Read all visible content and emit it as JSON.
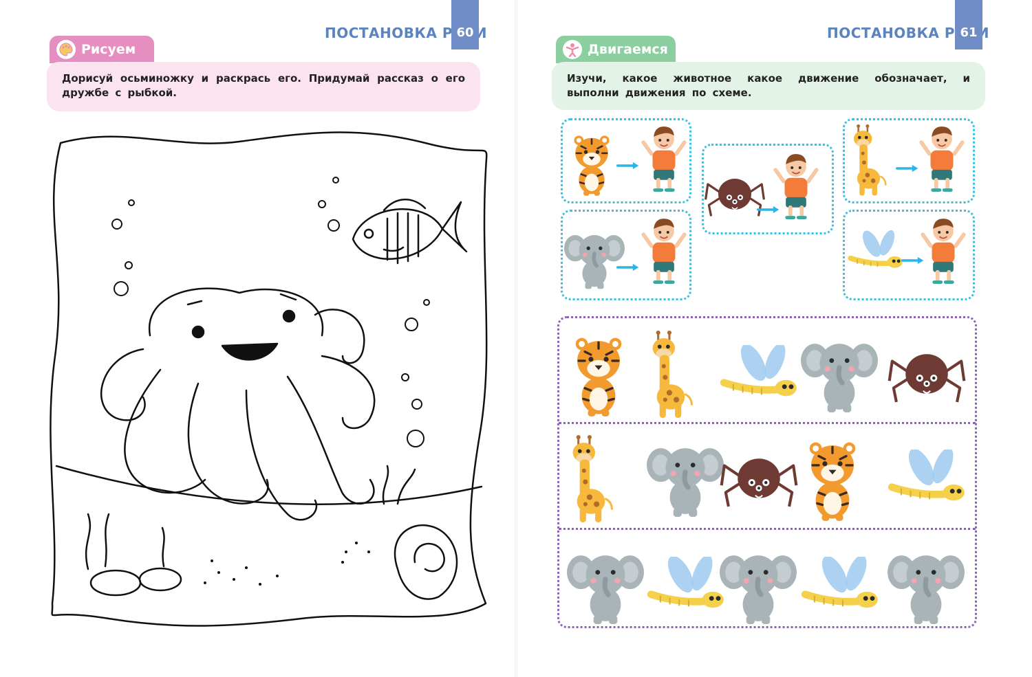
{
  "left_page": {
    "running_head": "ПОСТАНОВКА РУКИ",
    "page_number": "60",
    "section_label": "Рисуем",
    "section_icon": "palette-icon",
    "section_color": "#e58ec0",
    "instruction": "Дорисуй осьминожку и раскрась его. Придумай рассказ о его дружбе с рыбкой."
  },
  "right_page": {
    "running_head": "ПОСТАНОВКА РУКИ",
    "page_number": "61",
    "section_label": "Двигаемся",
    "section_icon": "person-stretching-icon",
    "section_color": "#8bcfa0",
    "instruction": "Изучи, какое животное какое движение обозначает, и выполни движения по схеме.",
    "legend": [
      {
        "animal": "tiger",
        "movement": "waving hands"
      },
      {
        "animal": "spider",
        "movement": "arms raised"
      },
      {
        "animal": "giraffe",
        "movement": "waving hands"
      },
      {
        "animal": "elephant",
        "movement": "arms bent, step"
      },
      {
        "animal": "dragonfly",
        "movement": "arms bent, step"
      }
    ],
    "sequence_rows": [
      [
        "tiger",
        "giraffe",
        "dragonfly",
        "elephant",
        "spider"
      ],
      [
        "giraffe",
        "elephant",
        "spider",
        "tiger",
        "dragonfly"
      ],
      [
        "elephant",
        "dragonfly",
        "elephant",
        "dragonfly",
        "elephant"
      ]
    ]
  },
  "colors": {
    "accent_blue": "#6f8cc7",
    "pink_box": "#fbe3ef",
    "green_box": "#e3f3e7",
    "legend_border": "#3fbfe0",
    "grid_border": "#8b63b0",
    "tiger": "#f29a2e",
    "giraffe": "#f6b93b",
    "elephant": "#a9b4b8",
    "spider": "#6e3a33",
    "dragonfly_wing": "#9ec9ee",
    "dragonfly_body": "#f5d04a",
    "boy_shirt": "#f47c3a",
    "boy_shorts": "#2f7a78"
  }
}
